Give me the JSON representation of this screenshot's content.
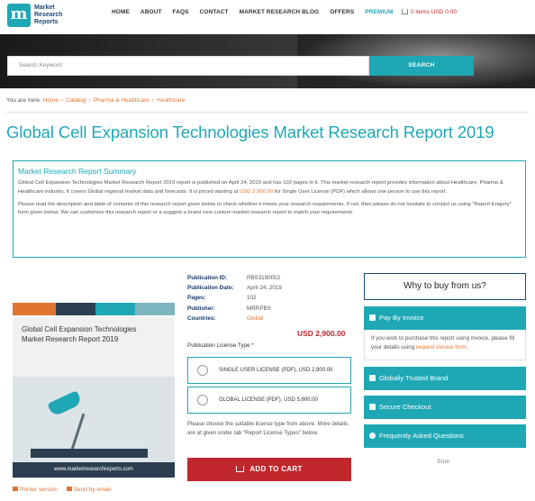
{
  "header": {
    "logo_letter": "m",
    "logo_lines": [
      "Market",
      "Research",
      "Reports"
    ],
    "nav": [
      "HOME",
      "ABOUT",
      "FAQS",
      "CONTACT",
      "MARKET RESEARCH BLOG",
      "OFFERS",
      "PREMIUM"
    ],
    "cart": "0 items USD 0.00"
  },
  "search": {
    "placeholder": "Search Keyword",
    "button": "SEARCH"
  },
  "breadcrumb": {
    "prefix": "You are here:",
    "items": [
      "Home",
      "Catalog",
      "Pharma & Healthcare",
      "Healthcare"
    ]
  },
  "title": "Global Cell Expansion Technologies Market Research Report 2019",
  "summary": {
    "heading": "Market Research Report Summary",
    "p1_a": "Global Cell Expansion Technologies Market Research Report 2019 report is published on April 24, 2019 and has 102 pages in it. This market research report provides information about Healthcare, Pharma & Healthcare industry. It covers Global regional market data and forecasts. It is priced starting at ",
    "p1_price": "USD 2,900.00",
    "p1_b": " for Single User License (PDF) which allows one person to use this report.",
    "p2": "Please read the description and table of contents of this research report given below to check whether it meets your research requirements. If not, then please do not hesitate to contact us using \"Report Enquiry\" form given below. We can customize this research report or a suggest a brand new custom market research report to match your requirements."
  },
  "product_image": {
    "title_line1": "Global Cell Expansion Technologies",
    "title_line2": "Market Research Report 2019",
    "footer": "www.marketresearchreports.com"
  },
  "links": {
    "printer": "Printer version",
    "email": "Send by email"
  },
  "publication": {
    "rows": [
      {
        "k": "Publication ID:",
        "v": "PBS3190052"
      },
      {
        "k": "Publication Date:",
        "v": "April 24, 2019"
      },
      {
        "k": "Pages:",
        "v": "102"
      },
      {
        "k": "Publisher:",
        "v": "MRRPBS"
      },
      {
        "k": "Countries:",
        "v": "Global"
      }
    ],
    "price": "USD 2,900.00",
    "license_label": "Publication License Type *",
    "licenses": [
      "SINGLE USER LICENSE (PDF), USD 2,900.00",
      "GLOBAL LICENSE (PDF), USD 5,800.00"
    ],
    "note": "Please choose the suitable license type from above. More details are at given under tab \"Report License Types\" below.",
    "add_to_cart": "ADD TO CART"
  },
  "sidebar": {
    "why": "Why to buy from us?",
    "pay_by_invoice": "Pay By Invoice",
    "invoice_text": "If you wish to purchase this report using invoice, please fill your details using ",
    "invoice_link": "request invoice form",
    "invoice_end": ".",
    "trusted": "Globally Trusted Brand",
    "checkout": "Secure Checkout",
    "faq": "Frequently Asked Questions",
    "error": "Error"
  },
  "colors": {
    "accent": "#1fa7b5",
    "orange": "#e27432",
    "red": "#c0282d",
    "navy": "#1a4a7a"
  }
}
